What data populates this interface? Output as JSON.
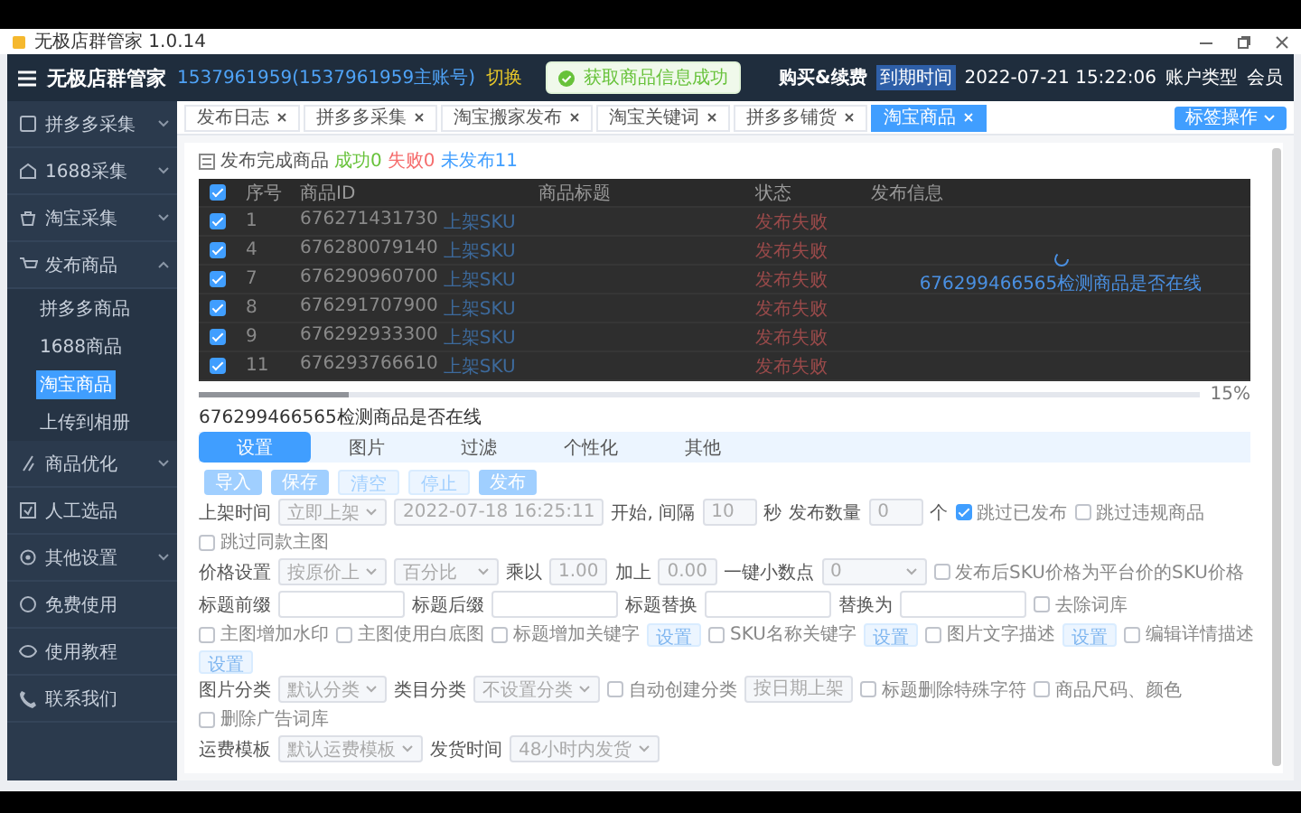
{
  "window": {
    "title": "无极店群管家 1.0.14"
  },
  "header": {
    "logo": "无极店群管家",
    "account": "1537961959(1537961959主账号)",
    "switch": "切换",
    "buy": "购买&续费",
    "expiry_label": "到期时间",
    "expiry": "2022-07-21 15:22:06",
    "type_label": "账户类型",
    "type": "会员"
  },
  "toast": {
    "message": "获取商品信息成功"
  },
  "sidebar": {
    "items": [
      {
        "label": "拼多多采集",
        "expanded": false,
        "selected": false
      },
      {
        "label": "1688采集",
        "expanded": false,
        "selected": false
      },
      {
        "label": "淘宝采集",
        "expanded": false,
        "selected": false
      },
      {
        "label": "发布商品",
        "expanded": true,
        "selected": false,
        "children": [
          {
            "label": "拼多多商品",
            "selected": false
          },
          {
            "label": "1688商品",
            "selected": false
          },
          {
            "label": "淘宝商品",
            "selected": true
          },
          {
            "label": "上传到相册",
            "selected": false
          }
        ]
      },
      {
        "label": "商品优化",
        "expanded": false,
        "selected": false
      },
      {
        "label": "人工选品",
        "selected": false
      },
      {
        "label": "其他设置",
        "expanded": false,
        "selected": false
      },
      {
        "label": "免费使用",
        "selected": false
      },
      {
        "label": "使用教程",
        "selected": false
      },
      {
        "label": "联系我们",
        "selected": false
      }
    ]
  },
  "tabs": [
    {
      "label": "发布日志",
      "selected": false
    },
    {
      "label": "拼多多采集",
      "selected": false
    },
    {
      "label": "淘宝搬家发布",
      "selected": false
    },
    {
      "label": "淘宝关键词",
      "selected": false
    },
    {
      "label": "拼多多铺货",
      "selected": false
    },
    {
      "label": "淘宝商品",
      "selected": true
    }
  ],
  "tab_menu": "标签操作",
  "summary": [
    {
      "kind": "plain",
      "text": "发布完成商品"
    },
    {
      "kind": "success",
      "text": "成功0"
    },
    {
      "kind": "fail",
      "text": "失败0"
    },
    {
      "kind": "info",
      "text": "未发布11"
    }
  ],
  "table": {
    "header_checked": true,
    "columns": [
      "序号",
      "商品ID",
      "商品标题",
      "状态",
      "发布信息"
    ],
    "rows": [
      {
        "checked": true,
        "no": "1",
        "id": "676271431730",
        "link": "上架SKU",
        "status": "发布失败"
      },
      {
        "checked": true,
        "no": "4",
        "id": "676280079140",
        "link": "上架SKU",
        "status": "发布失败"
      },
      {
        "checked": true,
        "no": "7",
        "id": "676290960700",
        "link": "上架SKU",
        "status": "发布失败"
      },
      {
        "checked": true,
        "no": "8",
        "id": "676291707900",
        "link": "上架SKU",
        "status": "发布失败"
      },
      {
        "checked": true,
        "no": "9",
        "id": "676292933300",
        "link": "上架SKU",
        "status": "发布失败"
      },
      {
        "checked": true,
        "no": "11",
        "id": "676293766610",
        "link": "上架SKU",
        "status": "发布失败"
      }
    ],
    "loading_text": "676299466565检测商品是否在线"
  },
  "progress": {
    "level": 0.15,
    "reading": "15%",
    "message": "676299466565检测商品是否在线"
  },
  "form": {
    "tabs": [
      {
        "label": "设置",
        "selected": true
      },
      {
        "label": "图片",
        "selected": false
      },
      {
        "label": "过滤",
        "selected": false
      },
      {
        "label": "个性化",
        "selected": false
      },
      {
        "label": "其他",
        "selected": false
      }
    ],
    "actions": [
      {
        "label": "导入",
        "disabled": false
      },
      {
        "label": "保存",
        "disabled": false
      },
      {
        "label": "清空",
        "disabled": true
      },
      {
        "label": "停止",
        "disabled": true
      },
      {
        "label": "发布",
        "disabled": false
      }
    ],
    "fields": [
      {
        "items": [
          {
            "kind": "label",
            "text": "上架时间"
          },
          {
            "kind": "select",
            "value": "立即上架"
          },
          {
            "kind": "input",
            "value": "2022-07-18 16:25:11"
          },
          {
            "kind": "text",
            "text": "开始, 间隔"
          },
          {
            "kind": "input",
            "value": "10"
          },
          {
            "kind": "text",
            "text": "秒"
          },
          {
            "kind": "label",
            "text": "发布数量"
          },
          {
            "kind": "input",
            "value": "0"
          },
          {
            "kind": "text",
            "text": "个"
          },
          {
            "kind": "checkbox",
            "text": "跳过已发布",
            "checked": true
          },
          {
            "kind": "checkbox",
            "text": "跳过违规商品",
            "checked": false
          },
          {
            "kind": "checkbox",
            "text": "跳过同款主图",
            "checked": false
          }
        ]
      },
      {
        "items": [
          {
            "kind": "label",
            "text": "价格设置"
          },
          {
            "kind": "select",
            "value": "按原价上"
          },
          {
            "kind": "select",
            "value": "百分比"
          },
          {
            "kind": "text",
            "text": "乘以"
          },
          {
            "kind": "input",
            "value": "1.00"
          },
          {
            "kind": "text",
            "text": "加上"
          },
          {
            "kind": "input",
            "value": "0.00"
          },
          {
            "kind": "text",
            "text": "一键小数点"
          },
          {
            "kind": "select",
            "value": "0"
          },
          {
            "kind": "checkbox",
            "text": "发布后SKU价格为平台价的SKU价格",
            "checked": false
          }
        ]
      },
      {
        "items": [
          {
            "kind": "label",
            "text": "标题前缀"
          },
          {
            "kind": "input"
          },
          {
            "kind": "label",
            "text": "标题后缀"
          },
          {
            "kind": "input"
          },
          {
            "kind": "label",
            "text": "标题替换"
          },
          {
            "kind": "input"
          },
          {
            "kind": "label",
            "text": "替换为"
          },
          {
            "kind": "input"
          },
          {
            "kind": "checkbox",
            "text": "去除词库",
            "checked": false
          }
        ]
      },
      {
        "items": [
          {
            "kind": "checkbox",
            "text": "主图增加水印",
            "checked": false
          },
          {
            "kind": "checkbox",
            "text": "主图使用白底图",
            "checked": false
          },
          {
            "kind": "checkbox",
            "text": "标题增加关键字",
            "checked": false
          },
          {
            "kind": "button",
            "text": "设置"
          },
          {
            "kind": "checkbox",
            "text": "SKU名称关键字",
            "checked": false
          },
          {
            "kind": "button",
            "text": "设置"
          },
          {
            "kind": "checkbox",
            "text": "图片文字描述",
            "checked": false
          },
          {
            "kind": "button",
            "text": "设置"
          },
          {
            "kind": "checkbox",
            "text": "编辑详情描述",
            "checked": false
          },
          {
            "kind": "button",
            "text": "设置"
          }
        ]
      },
      {
        "items": [
          {
            "kind": "label",
            "text": "图片分类"
          },
          {
            "kind": "select",
            "value": "默认分类"
          },
          {
            "kind": "label",
            "text": "类目分类"
          },
          {
            "kind": "select",
            "value": "不设置分类"
          },
          {
            "kind": "checkbox",
            "text": "自动创建分类",
            "checked": false
          },
          {
            "kind": "input",
            "value": "按日期上架"
          },
          {
            "kind": "checkbox",
            "text": "标题删除特殊字符",
            "checked": false
          },
          {
            "kind": "checkbox",
            "text": "商品尺码、颜色",
            "checked": false
          },
          {
            "kind": "checkbox",
            "text": "删除广告词库",
            "checked": false
          }
        ]
      },
      {
        "items": [
          {
            "kind": "label",
            "text": "运费模板"
          },
          {
            "kind": "select",
            "value": "默认运费模板"
          },
          {
            "kind": "label",
            "text": "发货时间"
          },
          {
            "kind": "select",
            "value": "48小时内发货"
          }
        ]
      }
    ]
  }
}
